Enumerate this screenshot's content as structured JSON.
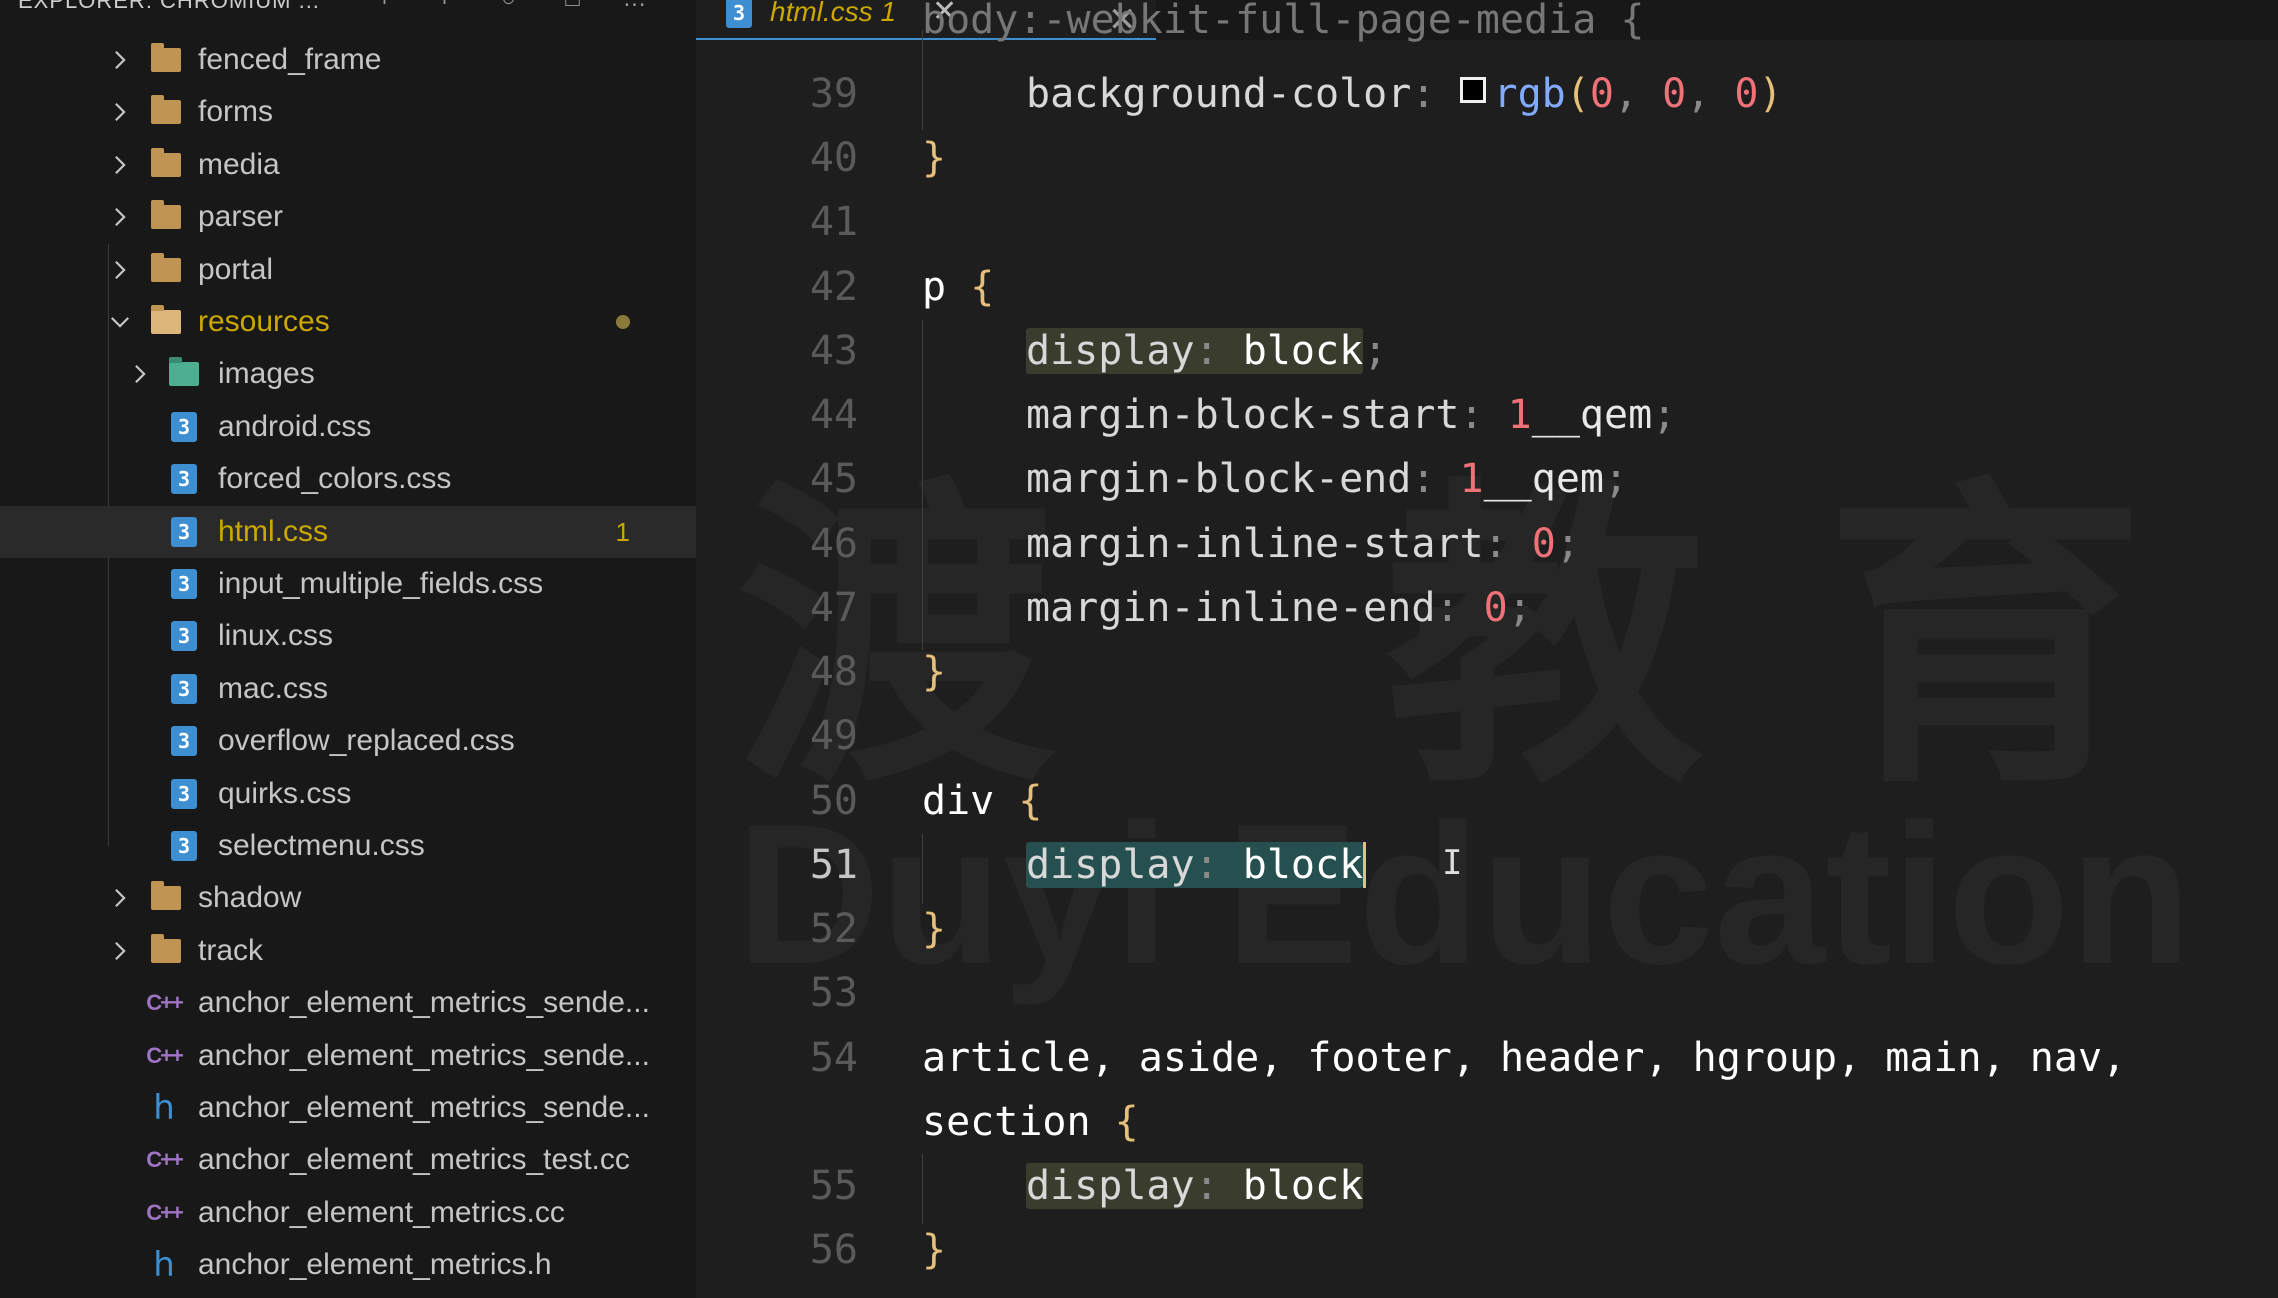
{
  "sidebar": {
    "header_title": "EXPLORER: CHROMIUM ...",
    "header_actions": [
      "new-file-icon",
      "new-folder-icon",
      "refresh-icon",
      "collapse-icon",
      "more-icon"
    ],
    "items": [
      {
        "label": "fenced_frame",
        "kind": "folder",
        "expanded": false
      },
      {
        "label": "forms",
        "kind": "folder",
        "expanded": false
      },
      {
        "label": "media",
        "kind": "folder",
        "expanded": false
      },
      {
        "label": "parser",
        "kind": "folder",
        "expanded": false
      },
      {
        "label": "portal",
        "kind": "folder",
        "expanded": false
      },
      {
        "label": "resources",
        "kind": "folder-open",
        "expanded": true
      },
      {
        "label": "images",
        "kind": "image-folder",
        "expanded": false
      },
      {
        "label": "android.css",
        "kind": "css"
      },
      {
        "label": "forced_colors.css",
        "kind": "css"
      },
      {
        "label": "html.css",
        "kind": "css",
        "badge": "1"
      },
      {
        "label": "input_multiple_fields.css",
        "kind": "css"
      },
      {
        "label": "linux.css",
        "kind": "css"
      },
      {
        "label": "mac.css",
        "kind": "css"
      },
      {
        "label": "overflow_replaced.css",
        "kind": "css"
      },
      {
        "label": "quirks.css",
        "kind": "css"
      },
      {
        "label": "selectmenu.css",
        "kind": "css"
      },
      {
        "label": "shadow",
        "kind": "folder",
        "expanded": false
      },
      {
        "label": "track",
        "kind": "folder",
        "expanded": false
      },
      {
        "label": "anchor_element_metrics_sende...",
        "kind": "cpp"
      },
      {
        "label": "anchor_element_metrics_sende...",
        "kind": "cpp"
      },
      {
        "label": "anchor_element_metrics_sende...",
        "kind": "h"
      },
      {
        "label": "anchor_element_metrics_test.cc",
        "kind": "cpp"
      },
      {
        "label": "anchor_element_metrics.cc",
        "kind": "cpp"
      },
      {
        "label": "anchor_element_metrics.h",
        "kind": "h"
      }
    ]
  },
  "tab": {
    "label": "html.css 1",
    "close_icon": "close-icon"
  },
  "editor": {
    "partial_top_line": "body:-webkit-full-page-media {",
    "lines": [
      {
        "n": "39",
        "text": "background-color: rgb(0, 0, 0)"
      },
      {
        "n": "40",
        "text": "}"
      },
      {
        "n": "41",
        "text": ""
      },
      {
        "n": "42",
        "text": "p {"
      },
      {
        "n": "43",
        "text": "display: block;"
      },
      {
        "n": "44",
        "text": "margin-block-start: 1__qem;"
      },
      {
        "n": "45",
        "text": "margin-block-end: 1__qem;"
      },
      {
        "n": "46",
        "text": "margin-inline-start: 0;"
      },
      {
        "n": "47",
        "text": "margin-inline-end: 0;"
      },
      {
        "n": "48",
        "text": "}"
      },
      {
        "n": "49",
        "text": ""
      },
      {
        "n": "50",
        "text": "div {"
      },
      {
        "n": "51",
        "text": "display: block"
      },
      {
        "n": "52",
        "text": "}"
      },
      {
        "n": "53",
        "text": ""
      },
      {
        "n": "54",
        "text": "article, aside, footer, header, hgroup, main, nav,"
      },
      {
        "n": "",
        "text": "section {"
      },
      {
        "n": "55",
        "text": "display: block"
      },
      {
        "n": "56",
        "text": "}"
      }
    ]
  },
  "colors": {
    "accent": "#3d8fd1",
    "warning": "#cca700",
    "number": "#f07178",
    "brace": "#e5c07b"
  }
}
